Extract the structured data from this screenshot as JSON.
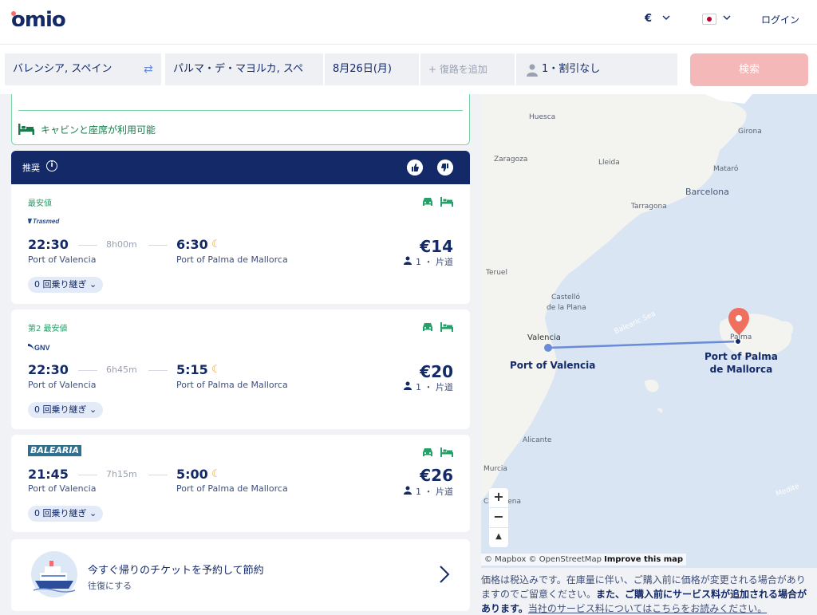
{
  "header": {
    "logo": "omio",
    "currency": "€",
    "login": "ログイン"
  },
  "search": {
    "from": "バレンシア, スペイン",
    "to": "パルマ・デ・マヨルカ, スペ",
    "date": "8月26日(月)",
    "return_placeholder": "+ 復路を追加",
    "passengers": "1・割引なし",
    "button": "検索"
  },
  "availability_note": "キャビンと座席が利用可能",
  "recommended": {
    "title": "推奨"
  },
  "trips": [
    {
      "tag": "最安値",
      "operator": "Trasmed",
      "depart": "22:30",
      "duration": "8h00m",
      "arrive": "6:30",
      "from_station": "Port of Valencia",
      "to_station": "Port of Palma de Mallorca",
      "price": "€14",
      "pax": "1 ・ 片道",
      "transfers": "0 回乗り継ぎ"
    },
    {
      "tag": "第2 最安値",
      "operator": "GNV",
      "depart": "22:30",
      "duration": "6h45m",
      "arrive": "5:15",
      "from_station": "Port of Valencia",
      "to_station": "Port of Palma de Mallorca",
      "price": "€20",
      "pax": "1 ・ 片道",
      "transfers": "0 回乗り継ぎ"
    },
    {
      "tag": "",
      "operator": "BALEARIA",
      "depart": "21:45",
      "duration": "7h15m",
      "arrive": "5:00",
      "from_station": "Port of Valencia",
      "to_station": "Port of Palma de Mallorca",
      "price": "€26",
      "pax": "1 ・ 片道",
      "transfers": "0 回乗り継ぎ"
    }
  ],
  "promo": {
    "title": "今すぐ帰りのチケットを予約して節約",
    "subtitle": "往復にする"
  },
  "map": {
    "labels": {
      "huesca": "Huesca",
      "girona": "Girona",
      "zaragoza": "Zaragoza",
      "lleida": "Lleida",
      "mataro": "Mataró",
      "barcelona": "Barcelona",
      "tarragona": "Tarragona",
      "teruel": "Teruel",
      "castello1": "Castelló",
      "castello2": "de la Plana",
      "balearic_sea": "Balearic Sea",
      "valencia": "Valencia",
      "palma": "Palma",
      "port_valencia": "Port of Valencia",
      "port_palma1": "Port of Palma",
      "port_palma2": "de Mallorca",
      "alicante": "Alicante",
      "murcia": "Murcia",
      "cartagena": "Cartagena",
      "mediterranean": "Medite"
    },
    "attribution": "© Mapbox © OpenStreetMap",
    "improve": "Improve this map"
  },
  "footnote": {
    "part1": "価格は税込みです。在庫量に伴い、ご購入前に価格が変更される場合がありますのでご留意ください。",
    "part2": "また、ご購入前にサービス料が追加される場合があります。",
    "link": "当社のサービス料についてはこちらをお読みください。"
  }
}
